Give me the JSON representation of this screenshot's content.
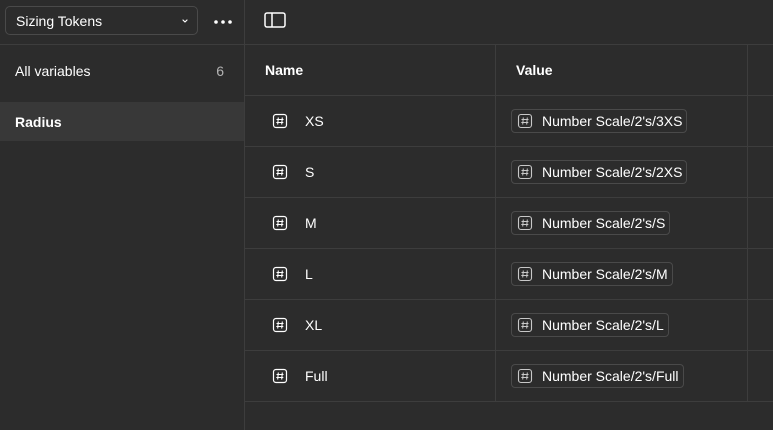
{
  "sidebar": {
    "collection_name": "Sizing Tokens",
    "all_variables_label": "All variables",
    "all_variables_count": "6",
    "groups": [
      {
        "label": "Radius"
      }
    ]
  },
  "table": {
    "columns": {
      "name": "Name",
      "value": "Value"
    },
    "rows": [
      {
        "name": "XS",
        "value": "Number Scale/2's/3XS"
      },
      {
        "name": "S",
        "value": "Number Scale/2's/2XS"
      },
      {
        "name": "M",
        "value": "Number Scale/2's/S"
      },
      {
        "name": "L",
        "value": "Number Scale/2's/M"
      },
      {
        "name": "XL",
        "value": "Number Scale/2's/L"
      },
      {
        "name": "Full",
        "value": "Number Scale/2's/Full"
      }
    ]
  },
  "icons": {
    "collection_chevron": "chevron-down-icon",
    "more": "more-horizontal-icon",
    "panel_toggle": "sidebar-toggle-icon",
    "number_variable": "number-variable-icon"
  },
  "colors": {
    "background": "#2c2c2c",
    "selected_row": "#383838",
    "border": "#3d3d3d",
    "text": "#ffffff",
    "muted_text": "#b3b3b3"
  }
}
